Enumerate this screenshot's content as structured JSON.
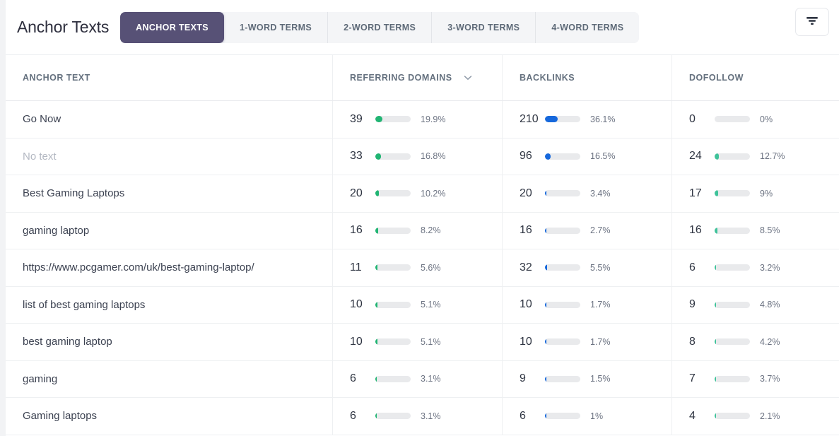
{
  "header": {
    "title": "Anchor Texts",
    "tabs": [
      {
        "label": "ANCHOR TEXTS",
        "active": true
      },
      {
        "label": "1-WORD TERMS",
        "active": false
      },
      {
        "label": "2-WORD TERMS",
        "active": false
      },
      {
        "label": "3-WORD TERMS",
        "active": false
      },
      {
        "label": "4-WORD TERMS",
        "active": false
      }
    ],
    "filter_icon": "filter-icon",
    "active_tab_color": "#575176"
  },
  "table": {
    "columns": [
      {
        "label": "ANCHOR TEXT",
        "sortable": false
      },
      {
        "label": "REFERRING DOMAINS",
        "sortable": true,
        "sort_icon": "chevron-down-icon"
      },
      {
        "label": "BACKLINKS",
        "sortable": false
      },
      {
        "label": "DOFOLLOW",
        "sortable": false
      }
    ],
    "colors": {
      "referring_domains_bar": "#21b573",
      "backlinks_bar": "#1668dc",
      "dofollow_bar": "#3fc39a",
      "bar_track": "#e9eaec"
    },
    "rows": [
      {
        "anchor": "Go Now",
        "muted": false,
        "referring_domains": {
          "value": "39",
          "pct": "19.9%",
          "fill": 19.9
        },
        "backlinks": {
          "value": "210",
          "pct": "36.1%",
          "fill": 36.1
        },
        "dofollow": {
          "value": "0",
          "pct": "0%",
          "fill": 0
        }
      },
      {
        "anchor": "No text",
        "muted": true,
        "referring_domains": {
          "value": "33",
          "pct": "16.8%",
          "fill": 16.8
        },
        "backlinks": {
          "value": "96",
          "pct": "16.5%",
          "fill": 16.5
        },
        "dofollow": {
          "value": "24",
          "pct": "12.7%",
          "fill": 12.7
        }
      },
      {
        "anchor": "Best Gaming Laptops",
        "muted": false,
        "referring_domains": {
          "value": "20",
          "pct": "10.2%",
          "fill": 10.2
        },
        "backlinks": {
          "value": "20",
          "pct": "3.4%",
          "fill": 3.4
        },
        "dofollow": {
          "value": "17",
          "pct": "9%",
          "fill": 9
        }
      },
      {
        "anchor": "gaming laptop",
        "muted": false,
        "referring_domains": {
          "value": "16",
          "pct": "8.2%",
          "fill": 8.2
        },
        "backlinks": {
          "value": "16",
          "pct": "2.7%",
          "fill": 2.7
        },
        "dofollow": {
          "value": "16",
          "pct": "8.5%",
          "fill": 8.5
        }
      },
      {
        "anchor": "https://www.pcgamer.com/uk/best-gaming-laptop/",
        "muted": false,
        "referring_domains": {
          "value": "11",
          "pct": "5.6%",
          "fill": 5.6
        },
        "backlinks": {
          "value": "32",
          "pct": "5.5%",
          "fill": 5.5
        },
        "dofollow": {
          "value": "6",
          "pct": "3.2%",
          "fill": 3.2
        }
      },
      {
        "anchor": "list of best gaming laptops",
        "muted": false,
        "referring_domains": {
          "value": "10",
          "pct": "5.1%",
          "fill": 5.1
        },
        "backlinks": {
          "value": "10",
          "pct": "1.7%",
          "fill": 1.7
        },
        "dofollow": {
          "value": "9",
          "pct": "4.8%",
          "fill": 4.8
        }
      },
      {
        "anchor": "best gaming laptop",
        "muted": false,
        "referring_domains": {
          "value": "10",
          "pct": "5.1%",
          "fill": 5.1
        },
        "backlinks": {
          "value": "10",
          "pct": "1.7%",
          "fill": 1.7
        },
        "dofollow": {
          "value": "8",
          "pct": "4.2%",
          "fill": 4.2
        }
      },
      {
        "anchor": "gaming",
        "muted": false,
        "referring_domains": {
          "value": "6",
          "pct": "3.1%",
          "fill": 3.1
        },
        "backlinks": {
          "value": "9",
          "pct": "1.5%",
          "fill": 1.5
        },
        "dofollow": {
          "value": "7",
          "pct": "3.7%",
          "fill": 3.7
        }
      },
      {
        "anchor": "Gaming laptops",
        "muted": false,
        "referring_domains": {
          "value": "6",
          "pct": "3.1%",
          "fill": 3.1
        },
        "backlinks": {
          "value": "6",
          "pct": "1%",
          "fill": 1
        },
        "dofollow": {
          "value": "4",
          "pct": "2.1%",
          "fill": 2.1
        }
      }
    ]
  }
}
